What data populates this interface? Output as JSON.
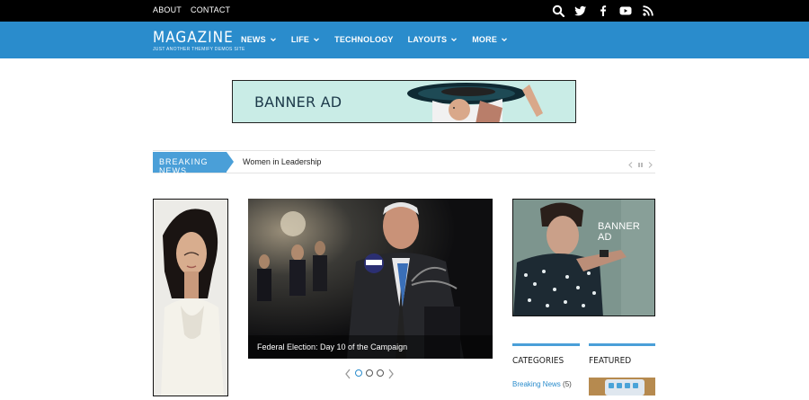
{
  "topbar": {
    "links": [
      "ABOUT",
      "CONTACT"
    ],
    "social_icons": [
      "search-icon",
      "twitter-icon",
      "facebook-icon",
      "youtube-icon",
      "rss-icon"
    ]
  },
  "header": {
    "logo": "MAGAZINE",
    "tagline": "JUST ANOTHER THEMIFY DEMOS SITE",
    "menu": [
      {
        "label": "NEWS",
        "has_dropdown": true
      },
      {
        "label": "LIFE",
        "has_dropdown": true
      },
      {
        "label": "TECHNOLOGY",
        "has_dropdown": false
      },
      {
        "label": "LAYOUTS",
        "has_dropdown": true
      },
      {
        "label": "MORE",
        "has_dropdown": true
      }
    ]
  },
  "top_banner": {
    "label": "BANNER AD"
  },
  "breaking_news": {
    "tag": "BREAKING NEWS",
    "headline": "Women in Leadership"
  },
  "slider": {
    "caption": "Federal Election: Day 10 of the Campaign",
    "active_dot": 0,
    "dot_count": 3
  },
  "right_banner": {
    "label": "BANNER AD"
  },
  "sidebar": {
    "categories_title": "CATEGORIES",
    "featured_title": "FEATURED",
    "categories": [
      {
        "name": "Breaking News",
        "count": "(5)"
      }
    ]
  },
  "colors": {
    "brand_blue": "#2a8ccc",
    "tag_blue": "#4a9fd8",
    "topbar": "#000000"
  }
}
